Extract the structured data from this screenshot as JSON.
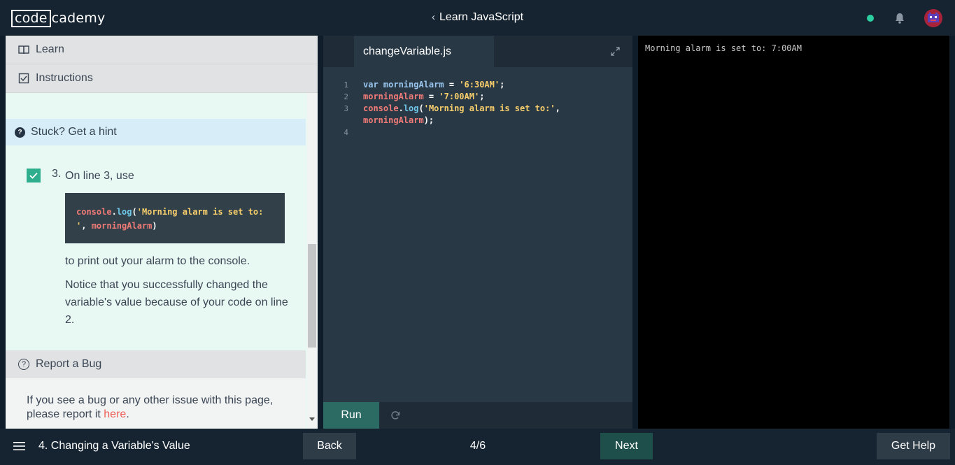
{
  "header": {
    "logo_box": "code",
    "logo_rest": "cademy",
    "course_title": "Learn JavaScript",
    "back_chevron": "‹",
    "status_color": "#2bcfa0",
    "notification_icon": "bell-icon",
    "avatar_icon": "avatar-icon"
  },
  "left_panel": {
    "learn_tab": "Learn",
    "instructions_tab": "Instructions",
    "hint": "Stuck? Get a hint",
    "step_number": "3.",
    "step_intro": "On line 3, use",
    "code_snippet": {
      "obj": "console",
      "dot": ".",
      "fn": "log",
      "open": "(",
      "str": "'Morning alarm is set to: '",
      "comma": ", ",
      "arg": "morningAlarm",
      "close": ")"
    },
    "para1": "to print out your alarm to the console.",
    "para2": "Notice that you successfully changed the variable's value because of your code on line 2.",
    "report_bug": "Report a Bug",
    "bug_text": "If you see a bug or any other issue with this page, please report it ",
    "bug_link": "here",
    "bug_text_end": "."
  },
  "editor": {
    "filename": "changeVariable.js",
    "line_numbers": [
      "1",
      "2",
      "3",
      "",
      "4"
    ],
    "line1": {
      "kw": "var ",
      "name": "morningAlarm",
      "op": " = ",
      "str": "'6:30AM'",
      "end": ";"
    },
    "line2": {
      "name": "morningAlarm",
      "op": " = ",
      "str": "'7:00AM'",
      "end": ";"
    },
    "line3": {
      "obj": "console",
      "dot": ".",
      "fn": "log",
      "open": "(",
      "str": "'Morning alarm is set to:'",
      "comma": ","
    },
    "line3b": {
      "arg": "morningAlarm",
      "end": ");"
    },
    "run_label": "Run"
  },
  "console": {
    "output": "Morning alarm is set to: 7:00AM"
  },
  "footer": {
    "lesson_title": "4. Changing a Variable's Value",
    "back_label": "Back",
    "progress": "4/6",
    "next_label": "Next",
    "help_label": "Get Help"
  }
}
